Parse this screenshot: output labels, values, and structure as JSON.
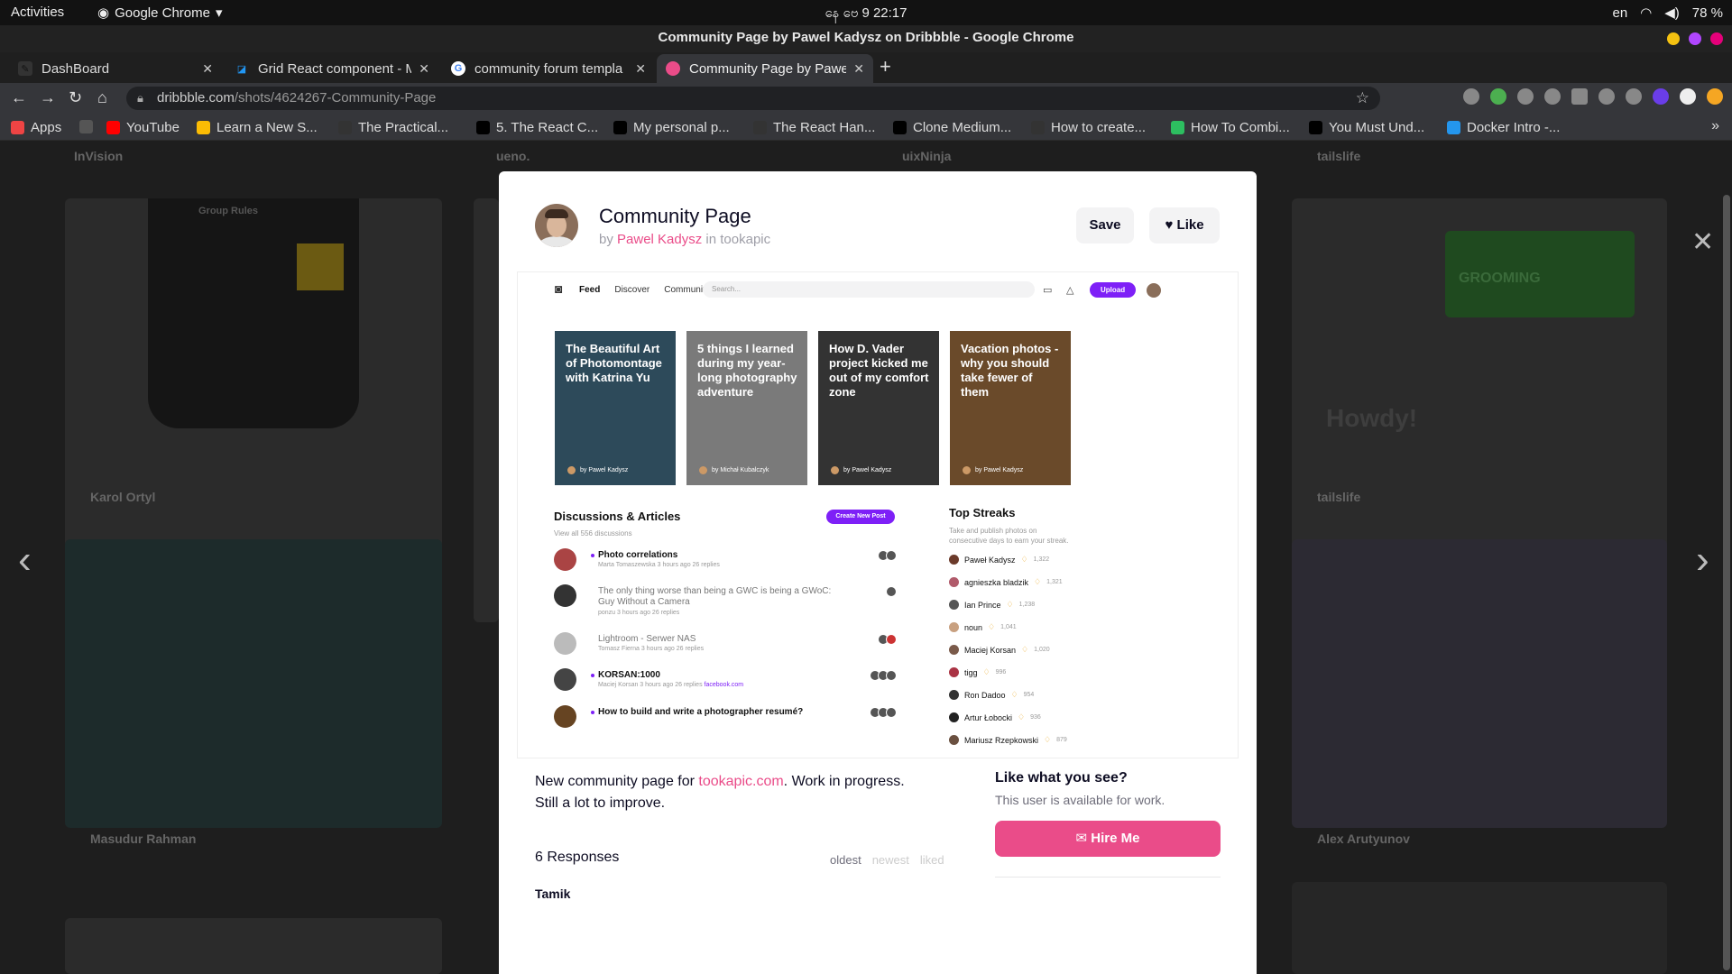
{
  "system": {
    "activities": "Activities",
    "app": "Google Chrome",
    "clock": "နေ ဗေ 9  22:17",
    "lang": "en",
    "battery": "78 %"
  },
  "window": {
    "title": "Community Page by Pawel Kadysz on Dribbble - Google Chrome"
  },
  "tabs": [
    {
      "label": "DashBoard",
      "icon": "dashboard-icon"
    },
    {
      "label": "Grid React component - M",
      "icon": "mui-icon"
    },
    {
      "label": "community forum templa",
      "icon": "google-icon"
    },
    {
      "label": "Community Page by Pawe",
      "icon": "dribbble-icon"
    }
  ],
  "address": {
    "domain": "dribbble.com",
    "path": "/shots/4624267-Community-Page"
  },
  "bookmarks": [
    {
      "label": "Apps",
      "icon": "apps-grid-icon",
      "color": "#e44"
    },
    {
      "label": "",
      "icon": "globe-icon",
      "color": "#555"
    },
    {
      "label": "YouTube",
      "icon": "youtube-icon",
      "color": "#f00"
    },
    {
      "label": "Learn a New S...",
      "icon": "codecademy-icon",
      "color": "#fbbc04"
    },
    {
      "label": "The Practical...",
      "icon": "react-icon",
      "color": "#333"
    },
    {
      "label": "5. The React C...",
      "icon": "medium-icon",
      "color": "#000"
    },
    {
      "label": "My personal p...",
      "icon": "dev-icon",
      "color": "#000"
    },
    {
      "label": "The React Han...",
      "icon": "react-icon",
      "color": "#333"
    },
    {
      "label": "Clone Medium...",
      "icon": "medium-icon",
      "color": "#000"
    },
    {
      "label": "How to create...",
      "icon": "react-icon",
      "color": "#333"
    },
    {
      "label": "How To Combi...",
      "icon": "evernote-icon",
      "color": "#2dbe60"
    },
    {
      "label": "You Must Und...",
      "icon": "medium-icon",
      "color": "#000"
    },
    {
      "label": "Docker Intro -...",
      "icon": "docker-icon",
      "color": "#2496ed"
    }
  ],
  "background_meta": {
    "top": [
      "InVision",
      "ueno.",
      "uixNinja",
      "tailslife"
    ],
    "mid": [
      "Karol Ortyl",
      "tailslife"
    ],
    "bottom": [
      "Masudur Rahman",
      "Alex Arutyunov"
    ],
    "phone_text": "Group Rules",
    "grooming": "GROOMING",
    "howdy": "Howdy!"
  },
  "shot": {
    "title": "Community Page",
    "by": "by",
    "author": "Pawel Kadysz",
    "in": "in",
    "team": "tookapic",
    "save": "Save",
    "like": "Like"
  },
  "mock": {
    "nav": [
      "Feed",
      "Discover",
      "Community"
    ],
    "search": "Search...",
    "upload": "Upload",
    "cards": [
      {
        "title": "The Beautiful Art of Photomontage with Katrina Yu",
        "by": "by Pawel Kadysz",
        "color": "#2d4a5a"
      },
      {
        "title": "5 things I learned during my year-long photography adventure",
        "by": "by Michał Kubalczyk",
        "color": "#6a6a6a"
      },
      {
        "title": "How D. Vader project kicked me out of my comfort zone",
        "by": "by Pawel Kadysz",
        "color": "#3a3a3a"
      },
      {
        "title": "Vacation photos - why you should take fewer of them",
        "by": "by Pawel Kadysz",
        "color": "#5a4028"
      }
    ],
    "discussions_title": "Discussions & Articles",
    "discussions_sub": "View all 556 discussions",
    "create_post": "Create New Post",
    "discussions": [
      {
        "title": "Photo correlations",
        "meta": "Marta Tomaszewska   3 hours ago   26 replies",
        "link": "",
        "unread": true
      },
      {
        "title": "The only thing worse than being a GWC is being a GWoC: Guy Without a Camera",
        "meta": "ponzu   3 hours ago   26 replies",
        "link": "",
        "unread": false
      },
      {
        "title": "Lightroom - Serwer NAS",
        "meta": "Tomasz Fierna   3 hours ago   26 replies",
        "link": "",
        "unread": false
      },
      {
        "title": "KORSAN:1000",
        "meta": "Maciej Korsan   3 hours ago   26 replies",
        "link": "facebook.com",
        "unread": true
      },
      {
        "title": "How to build and write a photographer resumé?",
        "meta": "",
        "link": "",
        "unread": true
      }
    ],
    "streaks_title": "Top Streaks",
    "streaks_sub": "Take and publish photos on consecutive days to earn your streak.",
    "streaks": [
      {
        "name": "Paweł Kadysz",
        "n": "1,322"
      },
      {
        "name": "agnieszka bladzik",
        "n": "1,321"
      },
      {
        "name": "Ian Prince",
        "n": "1,238"
      },
      {
        "name": "noun",
        "n": "1,041"
      },
      {
        "name": "Maciej Korsan",
        "n": "1,020"
      },
      {
        "name": "tigg",
        "n": "996"
      },
      {
        "name": "Ron Dadoo",
        "n": "954"
      },
      {
        "name": "Artur Łobocki",
        "n": "936"
      },
      {
        "name": "Mariusz Rzepkowski",
        "n": "879"
      }
    ]
  },
  "description": {
    "pre": "New community page for ",
    "link": "tookapic.com",
    "post": ". Work in progress. Still a lot to improve."
  },
  "hire": {
    "title": "Like what you see?",
    "sub": "This user is available for work.",
    "button": "Hire Me"
  },
  "responses": {
    "title": "6 Responses",
    "sort": [
      "oldest",
      "newest",
      "liked"
    ],
    "first": "Tamik"
  }
}
